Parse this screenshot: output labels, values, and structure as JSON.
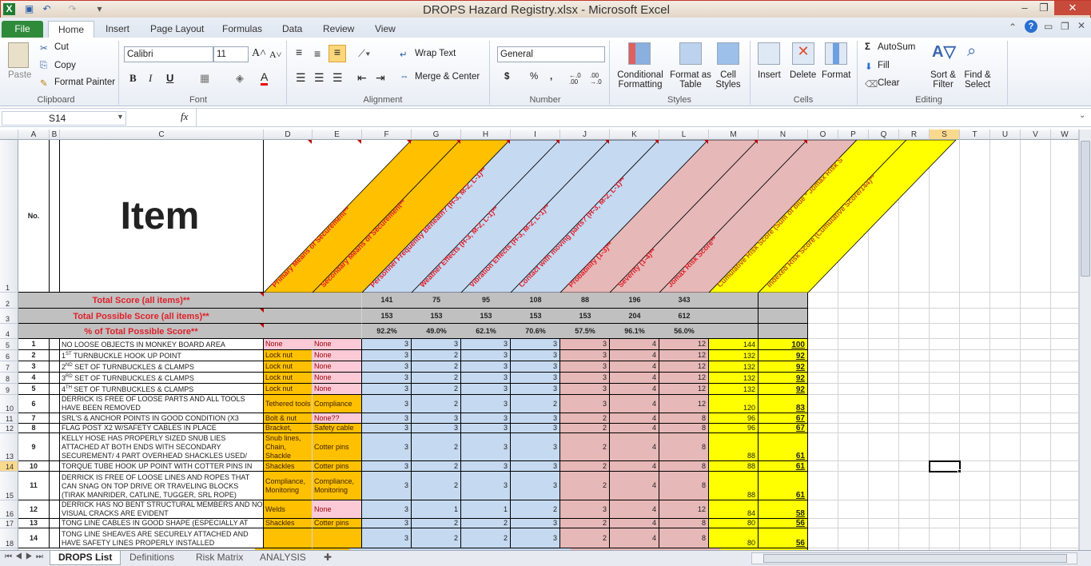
{
  "window": {
    "title": "DROPS Hazard Registry.xlsx  -  Microsoft Excel"
  },
  "ribbon_tabs": [
    "File",
    "Home",
    "Insert",
    "Page Layout",
    "Formulas",
    "Data",
    "Review",
    "View"
  ],
  "active_tab": "Home",
  "ribbon": {
    "clipboard": {
      "paste": "Paste",
      "cut": "Cut",
      "copy": "Copy",
      "format_painter": "Format Painter",
      "label": "Clipboard"
    },
    "font": {
      "name": "Calibri",
      "size": "11",
      "bold": "B",
      "italic": "I",
      "underline": "U",
      "label": "Font"
    },
    "alignment": {
      "wrap": "Wrap Text",
      "merge": "Merge & Center",
      "label": "Alignment"
    },
    "number": {
      "format": "General",
      "currency": "$",
      "percent": "%",
      "comma": ",",
      "inc_decimal": "←.0 .00",
      "dec_decimal": ".00 →.0",
      "label": "Number"
    },
    "styles": {
      "conditional": "Conditional Formatting",
      "format_table": "Format as Table",
      "cell_styles": "Cell Styles",
      "label": "Styles"
    },
    "cells": {
      "insert": "Insert",
      "delete": "Delete",
      "format": "Format",
      "label": "Cells"
    },
    "editing": {
      "autosum": "AutoSum",
      "fill": "Fill",
      "clear": "Clear",
      "sort": "Sort & Filter",
      "find": "Find & Select",
      "label": "Editing"
    }
  },
  "formula_bar": {
    "name_box": "S14",
    "fx": "fx",
    "value": ""
  },
  "columns": [
    "A",
    "B",
    "C",
    "D",
    "E",
    "F",
    "G",
    "H",
    "I",
    "J",
    "K",
    "L",
    "M",
    "N",
    "O",
    "P",
    "Q",
    "R",
    "S",
    "T",
    "U",
    "V",
    "W"
  ],
  "selected_cell": {
    "column": "S",
    "row": "14"
  },
  "sheet": {
    "header": {
      "no": "No.",
      "item": "Item",
      "diagonal_headers": [
        "Primary Means of Securement**",
        "Secondary Means of Securement**",
        "Personnel Frequently Beneath? (H-3, M-2, L-1)**",
        "Weather Effects (H-3, M-2, L-1)**",
        "Vibration Effects (H-3, M-2, L-1)**",
        "Contact with moving parts? (H-3, M-2, L-1)**",
        "Probability (1-3)**",
        "Severity (1-4)**",
        "Jomax Risk Score**",
        "Cumulative Risk Score (Sum of blue * Jomax Risk S",
        "Indexed Risk Score (Cumulative Score/144)**"
      ]
    },
    "colors": {
      "orange": "#ffc000",
      "blue": "#c5d9f1",
      "pink": "#e6b8b7",
      "yellow": "#ffff00",
      "none_pink": "#fbcad6",
      "grey": "#c0c0c0",
      "header_text": "#e0202a"
    },
    "summary": [
      {
        "label": "Total Score (all items)**",
        "values": [
          "141",
          "75",
          "95",
          "108",
          "88",
          "196",
          "343"
        ]
      },
      {
        "label": "Total Possible Score (all items)**",
        "values": [
          "153",
          "153",
          "153",
          "153",
          "153",
          "204",
          "612"
        ]
      },
      {
        "label": "% of Total Possible Score**",
        "values": [
          "92.2%",
          "49.0%",
          "62.1%",
          "70.6%",
          "57.5%",
          "96.1%",
          "56.0%"
        ]
      }
    ],
    "rows": [
      {
        "no": "1",
        "pre": "",
        "sup": "",
        "item": "NO LOOSE OBJECTS IN MONKEY BOARD AREA",
        "primary": "None",
        "primary_style": "pink",
        "secondary": "None",
        "secondary_style": "pink",
        "scores": [
          "3",
          "3",
          "3",
          "3"
        ],
        "prob": "3",
        "sev": "4",
        "jomax": "12",
        "cumulative": "144",
        "indexed": "100"
      },
      {
        "no": "2",
        "pre": "1",
        "sup": "ST",
        "item": " TURNBUCKLE HOOK UP POINT",
        "primary": "Lock nut",
        "primary_style": "orange",
        "secondary": "None",
        "secondary_style": "pink",
        "scores": [
          "3",
          "2",
          "3",
          "3"
        ],
        "prob": "3",
        "sev": "4",
        "jomax": "12",
        "cumulative": "132",
        "indexed": "92"
      },
      {
        "no": "3",
        "pre": "2",
        "sup": "ND",
        "item": " SET OF TURNBUCKLES & CLAMPS",
        "primary": "Lock nut",
        "primary_style": "orange",
        "secondary": "None",
        "secondary_style": "pink",
        "scores": [
          "3",
          "2",
          "3",
          "3"
        ],
        "prob": "3",
        "sev": "4",
        "jomax": "12",
        "cumulative": "132",
        "indexed": "92"
      },
      {
        "no": "4",
        "pre": "3",
        "sup": "RD",
        "item": " SET OF TURNBUCKLES & CLAMPS",
        "primary": "Lock nut",
        "primary_style": "orange",
        "secondary": "None",
        "secondary_style": "pink",
        "scores": [
          "3",
          "2",
          "3",
          "3"
        ],
        "prob": "3",
        "sev": "4",
        "jomax": "12",
        "cumulative": "132",
        "indexed": "92"
      },
      {
        "no": "5",
        "pre": "4",
        "sup": "TH",
        "item": " SET OF TURNBUCKLES & CLAMPS",
        "primary": "Lock nut",
        "primary_style": "orange",
        "secondary": "None",
        "secondary_style": "pink",
        "scores": [
          "3",
          "2",
          "3",
          "3"
        ],
        "prob": "3",
        "sev": "4",
        "jomax": "12",
        "cumulative": "132",
        "indexed": "92"
      },
      {
        "no": "6",
        "pre": "",
        "sup": "",
        "item": "DERRICK IS FREE OF LOOSE PARTS AND ALL TOOLS HAVE BEEN REMOVED",
        "primary": "Tethered tools",
        "primary_style": "orange",
        "secondary": "Compliance",
        "secondary_style": "orange",
        "scores": [
          "3",
          "2",
          "3",
          "2"
        ],
        "prob": "3",
        "sev": "4",
        "jomax": "12",
        "cumulative": "120",
        "indexed": "83"
      },
      {
        "no": "7",
        "pre": "",
        "sup": "",
        "item": "SRL'S & ANCHOR POINTS IN GOOD CONDITION (X3",
        "primary": "Bolt & nut",
        "primary_style": "orange",
        "secondary": "None??",
        "secondary_style": "pink",
        "scores": [
          "3",
          "3",
          "3",
          "3"
        ],
        "prob": "2",
        "sev": "4",
        "jomax": "8",
        "cumulative": "96",
        "indexed": "67"
      },
      {
        "no": "8",
        "pre": "",
        "sup": "",
        "item": "FLAG POST X2 W/SAFETY CABLES IN PLACE",
        "primary": "Bracket,",
        "primary_style": "orange",
        "secondary": "Safety cable",
        "secondary_style": "orange",
        "scores": [
          "3",
          "3",
          "3",
          "3"
        ],
        "prob": "2",
        "sev": "4",
        "jomax": "8",
        "cumulative": "96",
        "indexed": "67"
      },
      {
        "no": "9",
        "pre": "",
        "sup": "",
        "item": "KELLY HOSE HAS PROPERLY SIZED SNUB LIES ATTACHED AT BOTH ENDS WITH SECONDARY SECUREMENT/ 4 PART OVERHEAD SHACKLES USED/",
        "primary": "Snub lines, Chain, Shackle",
        "primary_style": "orange",
        "secondary": "Cotter pins",
        "secondary_style": "orange",
        "scores": [
          "3",
          "2",
          "3",
          "3"
        ],
        "prob": "2",
        "sev": "4",
        "jomax": "8",
        "cumulative": "88",
        "indexed": "61"
      },
      {
        "no": "10",
        "pre": "",
        "sup": "",
        "item": "TORQUE TUBE HOOK UP POINT WITH COTTER PINS IN",
        "primary": "Shackles",
        "primary_style": "orange",
        "secondary": "Cotter pins",
        "secondary_style": "orange",
        "scores": [
          "3",
          "2",
          "3",
          "3"
        ],
        "prob": "2",
        "sev": "4",
        "jomax": "8",
        "cumulative": "88",
        "indexed": "61"
      },
      {
        "no": "11",
        "pre": "",
        "sup": "",
        "item": "DERRICK IS FREE OF LOOSE LINES AND ROPES THAT CAN SNAG ON TOP DRIVE OR TRAVELING BLOCKS (TIRAK MANRIDER, CATLINE, TUGGER, SRL ROPE)",
        "primary": "Compliance, Monitoring",
        "primary_style": "orange",
        "secondary": "Compliance, Monitoring",
        "secondary_style": "orange",
        "scores": [
          "3",
          "2",
          "3",
          "3"
        ],
        "prob": "2",
        "sev": "4",
        "jomax": "8",
        "cumulative": "88",
        "indexed": "61"
      },
      {
        "no": "12",
        "pre": "",
        "sup": "",
        "item": "DERRICK HAS NO BENT STRUCTURAL MEMBERS AND NO VISUAL CRACKS ARE EVIDENT",
        "primary": "Welds",
        "primary_style": "orange",
        "secondary": "None",
        "secondary_style": "pink",
        "scores": [
          "3",
          "1",
          "1",
          "2"
        ],
        "prob": "3",
        "sev": "4",
        "jomax": "12",
        "cumulative": "84",
        "indexed": "58"
      },
      {
        "no": "13",
        "pre": "",
        "sup": "",
        "item": "TONG LINE CABLES IN GOOD SHAPE (ESPECIALLY AT",
        "primary": "Shackles",
        "primary_style": "orange",
        "secondary": "Cotter pins",
        "secondary_style": "orange",
        "scores": [
          "3",
          "2",
          "2",
          "3"
        ],
        "prob": "2",
        "sev": "4",
        "jomax": "8",
        "cumulative": "80",
        "indexed": "56"
      },
      {
        "no": "14",
        "pre": "",
        "sup": "",
        "item": "TONG LINE SHEAVES ARE SECURELY ATTACHED AND HAVE SAFETY LINES PROPERLY INSTALLED",
        "primary": "",
        "primary_style": "orange",
        "secondary": "",
        "secondary_style": "orange",
        "scores": [
          "3",
          "2",
          "2",
          "3"
        ],
        "prob": "2",
        "sev": "4",
        "jomax": "8",
        "cumulative": "80",
        "indexed": "56"
      }
    ]
  },
  "sheet_tabs": [
    "DROPS List",
    "Definitions",
    "Risk Matrix",
    "ANALYSIS"
  ],
  "active_sheet": "DROPS List"
}
